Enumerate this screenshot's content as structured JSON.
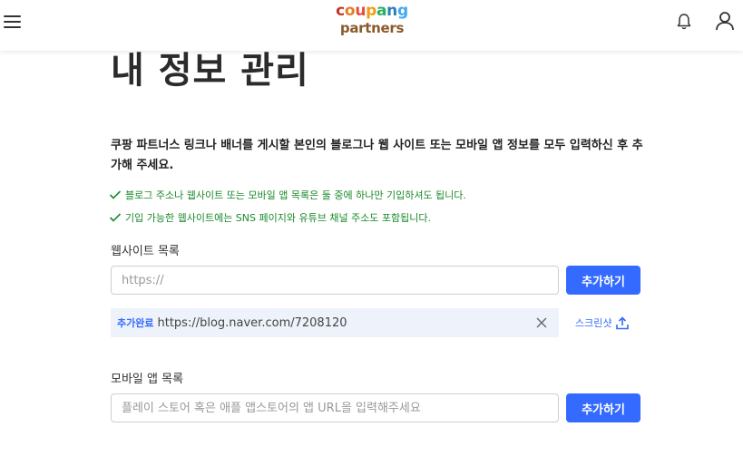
{
  "header": {
    "logo_coupang": "coupang",
    "logo_partners": "partners",
    "icons": [
      "menu-icon",
      "bell-icon",
      "user-icon"
    ]
  },
  "page": {
    "title": "내 정보 관리",
    "intro": "쿠팡 파트너스 링크나 배너를 게시할 본인의 블로그나 웹 사이트 또는 모바일 앱 정보를 모두 입력하신 후 추가해 주세요.",
    "notes": [
      "블로그 주소나 웹사이트 또는 모바일 앱 목록은 둘 중에 하나만 기입하셔도 됩니다.",
      "기입 가능한 웹사이트에는 SNS 페이지와 유튜브 채널 주소도 포함됩니다."
    ]
  },
  "website": {
    "label": "웹사이트 목록",
    "placeholder": "https://",
    "value": "",
    "add_label": "추가하기",
    "added": {
      "badge": "추가완료",
      "url": "https://blog.naver.com/7208120"
    },
    "screenshot_label": "스크린샷"
  },
  "mobile": {
    "label": "모바일 앱 목록",
    "placeholder": "플레이 스토어 혹은 애플 앱스토어의 앱 URL을 입력해주세요",
    "value": "",
    "add_label": "추가하기"
  },
  "colors": {
    "accent": "#346aff",
    "note_green": "#1a8a2a",
    "added_bg": "#eef3fb"
  }
}
